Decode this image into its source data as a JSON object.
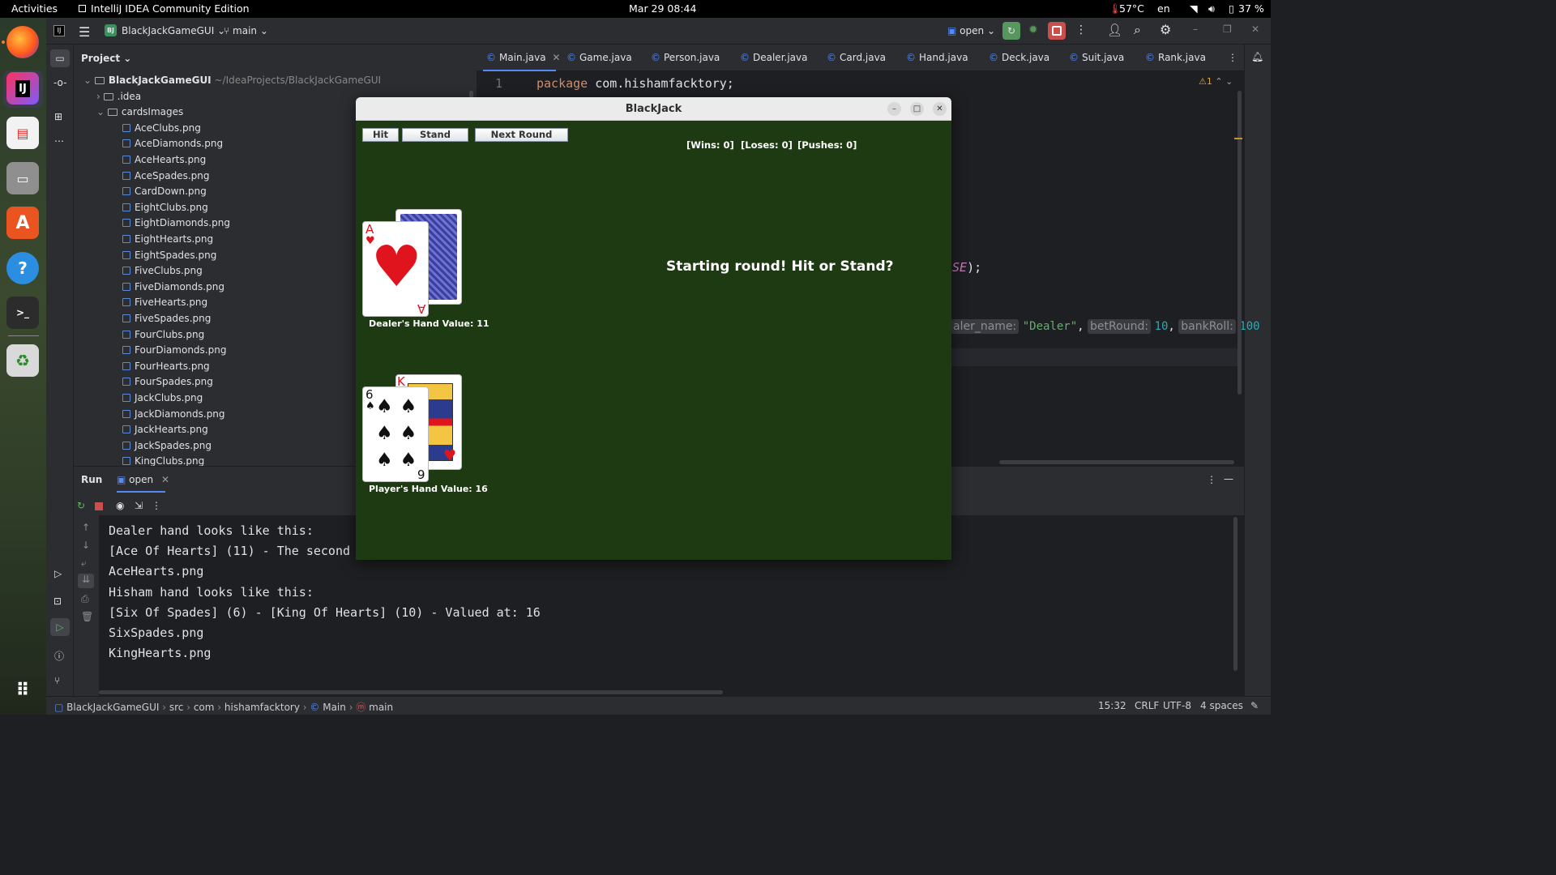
{
  "topbar": {
    "activities": "Activities",
    "app_title": "IntelliJ IDEA Community Edition",
    "datetime": "Mar 29  08:44",
    "temperature": "57°C",
    "lang": "en",
    "battery": "37 %"
  },
  "ide": {
    "project_badge": "BJ",
    "project_name": "BlackJackGameGUI",
    "branch": "main",
    "run_config": "open",
    "panel_title": "Project"
  },
  "tree": {
    "root_name": "BlackJackGameGUI",
    "root_path": "~/IdeaProjects/BlackJackGameGUI",
    "idea": ".idea",
    "folder": "cardsImages",
    "files": [
      "AceClubs.png",
      "AceDiamonds.png",
      "AceHearts.png",
      "AceSpades.png",
      "CardDown.png",
      "EightClubs.png",
      "EightDiamonds.png",
      "EightHearts.png",
      "EightSpades.png",
      "FiveClubs.png",
      "FiveDiamonds.png",
      "FiveHearts.png",
      "FiveSpades.png",
      "FourClubs.png",
      "FourDiamonds.png",
      "FourHearts.png",
      "FourSpades.png",
      "JackClubs.png",
      "JackDiamonds.png",
      "JackHearts.png",
      "JackSpades.png",
      "KingClubs.png"
    ]
  },
  "tabs": [
    "Main.java",
    "Game.java",
    "Person.java",
    "Dealer.java",
    "Card.java",
    "Hand.java",
    "Deck.java",
    "Suit.java",
    "Rank.java"
  ],
  "editor": {
    "line_number": "1",
    "keyword": "package",
    "package_name": "com.hishamfacktory;",
    "frag_se": "SE);",
    "hint_name": "aler_name:",
    "str_dealer": "\"Dealer\"",
    "hint_bet": "betRound:",
    "num_bet": "10",
    "hint_bank": "bankRoll:",
    "num_bank": "100",
    "warnings": "1"
  },
  "run": {
    "tab_run": "Run",
    "tab_open": "open",
    "lines": [
      "Dealer hand looks like this:",
      "[Ace Of Hearts] (11) - The second",
      "AceHearts.png",
      "Hisham hand looks like this:",
      "[Six Of Spades] (6) - [King Of Hearts] (10) -  Valued at: 16",
      "SixSpades.png",
      "KingHearts.png"
    ]
  },
  "statusbar": {
    "crumbs": [
      "BlackJackGameGUI",
      "src",
      "com",
      "hishamfacktory",
      "Main",
      "main"
    ],
    "position": "15:32",
    "line_sep": "CRLF",
    "encoding": "UTF-8",
    "indent": "4 spaces"
  },
  "blackjack": {
    "title": "BlackJack",
    "hit": "Hit",
    "stand": "Stand",
    "next_round": "Next Round",
    "wins": "[Wins: 0]",
    "loses": "[Loses: 0]",
    "pushes": "[Pushes: 0]",
    "message": "Starting round! Hit or Stand?",
    "dealer_value": "Dealer's Hand Value: 11",
    "player_value": "Player's Hand Value: 16",
    "dealer_card_rank": "A",
    "dealer_card_suit": "♥",
    "player_card1_rank": "6",
    "player_card1_suit": "♠",
    "player_card2_rank": "K",
    "player_card2_suit": "♥"
  },
  "colors": {
    "felt": "#1e3a12",
    "keyword": "#cf8e6d",
    "accent": "#548af7"
  }
}
